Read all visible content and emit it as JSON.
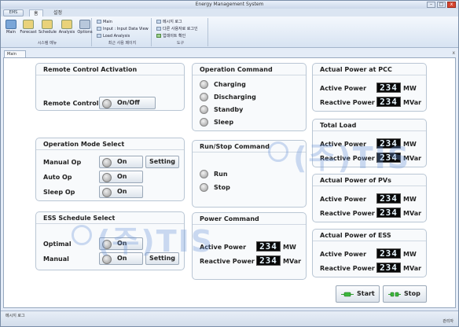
{
  "window": {
    "title": "Energy Management System",
    "min_label": "–",
    "max_label": "□",
    "close_label": "x"
  },
  "ribbon": {
    "app_button": "EMS",
    "tabs": [
      "홈",
      "설정"
    ],
    "groups": [
      {
        "label": "시스템 메뉴",
        "buttons": [
          "Main",
          "Forecast",
          "Schedule",
          "Analysis",
          "Options"
        ]
      },
      {
        "label": "최근 사용 페이지",
        "items": [
          "Main",
          "Input : Input Data View",
          "Load Analysis"
        ]
      },
      {
        "label": "도구",
        "items": [
          "메시지 로그",
          "다른 사용자로 로그인",
          "업데이트 확인"
        ]
      }
    ]
  },
  "doc_tab": "Main",
  "doc_close": "x",
  "remote": {
    "title": "Remote Control Activation",
    "label": "Remote Control",
    "toggle": "On/Off"
  },
  "opmode": {
    "title": "Operation Mode Select",
    "rows": [
      {
        "label": "Manual Op",
        "toggle": "On",
        "setting": "Setting"
      },
      {
        "label": "Auto Op",
        "toggle": "On"
      },
      {
        "label": "Sleep Op",
        "toggle": "On"
      }
    ]
  },
  "schedule": {
    "title": "ESS Schedule Select",
    "rows": [
      {
        "label": "Optimal",
        "toggle": "On"
      },
      {
        "label": "Manual",
        "toggle": "On",
        "setting": "Setting"
      }
    ]
  },
  "opcmd": {
    "title": "Operation Command",
    "items": [
      "Charging",
      "Discharging",
      "Standby",
      "Sleep"
    ]
  },
  "runstop": {
    "title": "Run/Stop Command",
    "items": [
      "Run",
      "Stop"
    ]
  },
  "power": {
    "title": "Power Command",
    "active_label": "Active Power",
    "active_value": "234",
    "active_unit": "MW",
    "reactive_label": "Reactive Power",
    "reactive_value": "234",
    "reactive_unit": "MVar"
  },
  "pcc": {
    "title": "Actual Power at PCC",
    "active_label": "Active Power",
    "active_value": "234",
    "active_unit": "MW",
    "reactive_label": "Reactive Power",
    "reactive_value": "234",
    "reactive_unit": "MVar"
  },
  "load": {
    "title": "Total Load",
    "active_label": "Active Power",
    "active_value": "234",
    "active_unit": "MW",
    "reactive_label": "Reactive Power",
    "reactive_value": "234",
    "reactive_unit": "MVar"
  },
  "pv": {
    "title": "Actual Power of PVs",
    "active_label": "Active Power",
    "active_value": "234",
    "active_unit": "MW",
    "reactive_label": "Reactive Power",
    "reactive_value": "234",
    "reactive_unit": "MVar"
  },
  "ess": {
    "title": "Actual Power of ESS",
    "active_label": "Active Power",
    "active_value": "234",
    "active_unit": "MW",
    "reactive_label": "Reactive Power",
    "reactive_value": "234",
    "reactive_unit": "MVar"
  },
  "controls": {
    "start": "Start",
    "stop": "Stop"
  },
  "watermark": {
    "text": "(주)TIS"
  },
  "status": {
    "left": "메시지 로그",
    "right": "관리자"
  },
  "colors": {
    "display_bg": "#080808",
    "display_fg": "#e8f6ff",
    "watermark": "#6996d7",
    "accent_green": "#2e9e2e"
  }
}
